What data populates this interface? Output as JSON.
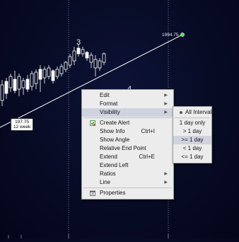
{
  "chart": {
    "top_price_label": "1994.75",
    "wave_label_3": "3",
    "wave_label_4": "4",
    "callout": {
      "price": "197.75",
      "duration": "12 week"
    }
  },
  "context_menu": {
    "items": [
      {
        "label": "Edit",
        "submenu": true
      },
      {
        "label": "Format",
        "submenu": true
      },
      {
        "label": "Visibility",
        "submenu": true,
        "highlighted": true
      },
      {
        "separator": true
      },
      {
        "label": "Create Alert",
        "icon": "alert-icon"
      },
      {
        "label": "Show Info",
        "shortcut": "Ctrl+I"
      },
      {
        "label": "Show Angle"
      },
      {
        "label": "Relative End Point"
      },
      {
        "label": "Extend",
        "shortcut": "Ctrl+E"
      },
      {
        "label": "Extend Left"
      },
      {
        "label": "Ratios",
        "submenu": true
      },
      {
        "label": "Line",
        "submenu": true
      },
      {
        "separator": true
      },
      {
        "label": "Properties",
        "icon": "properties-icon"
      }
    ]
  },
  "visibility_submenu": {
    "items": [
      {
        "label": "All Intervals",
        "selected": true
      },
      {
        "label": "1 day only"
      },
      {
        "label": "> 1 day"
      },
      {
        "label": ">= 1 day",
        "highlighted": true
      },
      {
        "label": "< 1 day"
      },
      {
        "label": "<= 1 day"
      }
    ]
  },
  "colors": {
    "background": "#070b24",
    "candle": "#ffffff",
    "trendline": "#ffffff",
    "anchor_dot": "#44dd55",
    "menu_bg": "#ececec",
    "menu_highlight": "#cfd3df"
  }
}
